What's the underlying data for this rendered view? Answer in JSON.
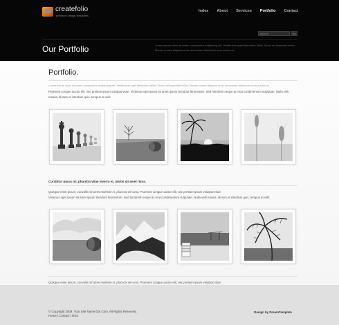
{
  "brand": {
    "name": "createfolio",
    "tagline": "premium design templates"
  },
  "nav": [
    "Index",
    "About",
    "Services",
    "Portfolio",
    "Contact"
  ],
  "nav_active": "Portfolio",
  "search": {
    "placeholder": "search",
    "button": "Go"
  },
  "header": {
    "title": "Our Portfolio",
    "blurb": "Lorem ipsum dolor sit amet, consectetur adipiscing elit. Vestibulum eget bibendum tellus. Nunc vel imperdiet tellus. Mauris ornare aliquam urna, accumsan bibendum eros auctor ac."
  },
  "main": {
    "title": "Portfolio.",
    "intro_small": "Lorem ipsum dolor sit amet, consectetur adipiscing elit. Vestibulum eget bibendum tellus. Nunc vel imperdiet tellus. Mauris ornare aliquam urna, accumsan bibendum eros auctor ac.",
    "intro_para": "Praesent congue auctor elit, nec pretium ipsum volutpat vitae. Vivamus eget ipsum sit amet ipsum tincidunt fermentum. Sed hendrerit neque ac erat condimentum vulputate. Nulla velit massa, dictum et interdum quis, tempus at velit.",
    "gallery1": [
      "chess-pieces",
      "hay-bale-field",
      "palm-sunset",
      "wheat-stalks"
    ],
    "bold_line": "Curabitur purus mi, pharetra vitae viverra et, mattis sit amet risus.",
    "italic_para": "Quisque enim ipsum, convallis sit amet molestie in, placerat vel urna. Praesent congue auctor elit, nec pretium ipsum volutpat vitae.",
    "para2": "Vivamus eget ipsum sit amet ipsum tincidunt fermentum. Sed hendrerit neque ac erat condimentum vulputate. Nulla velit massa, dictum et interdum quis, tempus at velit.",
    "gallery2": [
      "hay-bale-clouds",
      "snowy-mountains",
      "beach-chairs",
      "palm-fronds"
    ],
    "bottom_italic": "Quisque enim ipsum, convallis sit amet molestie in, placerat vel urna. Praesent congue auctor elit, nec pretium ipsum volutpat vitae.",
    "bottom_para": "Vivamus eget ipsum sit amet ipsum tincidunt fermentum. Sed hendrerit neque ac erat condimentum vulputate. Nulla velit massa, dictum et interdum quis, tempus at velit."
  },
  "footer": {
    "copyright": "© Copyright 2009. Your Site Name Dot Com. All Rights Reserved.",
    "links": [
      "Home",
      "Contact",
      "RSS"
    ],
    "credit": "Design by DreamTemplate"
  }
}
